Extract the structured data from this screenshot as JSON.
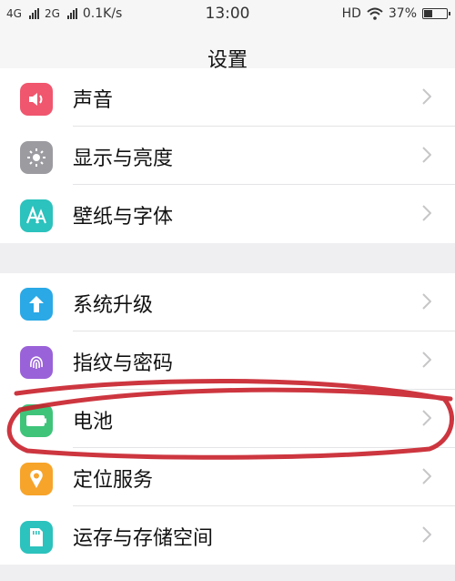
{
  "status_bar": {
    "net1": "4G",
    "net2": "2G",
    "speed": "0.1K/s",
    "time": "13:00",
    "hd": "HD",
    "battery_pct": "37%",
    "battery_level": 0.37
  },
  "header": {
    "title": "设置"
  },
  "groups": [
    {
      "items": [
        {
          "label": "声音",
          "icon": "speaker-icon",
          "color": "#f0566e"
        },
        {
          "label": "显示与亮度",
          "icon": "sun-icon",
          "color": "#9b9ba0"
        },
        {
          "label": "壁纸与字体",
          "icon": "font-icon",
          "color": "#2cc2bd"
        }
      ]
    },
    {
      "items": [
        {
          "label": "系统升级",
          "icon": "upgrade-icon",
          "color": "#2aa9e6"
        },
        {
          "label": "指纹与密码",
          "icon": "fingerprint-icon",
          "color": "#9a62d8"
        },
        {
          "label": "电池",
          "icon": "battery-icon",
          "color": "#3fc47a"
        },
        {
          "label": "定位服务",
          "icon": "location-icon",
          "color": "#f7a42a"
        },
        {
          "label": "运存与存储空间",
          "icon": "storage-icon",
          "color": "#2cc2bd"
        }
      ]
    }
  ]
}
